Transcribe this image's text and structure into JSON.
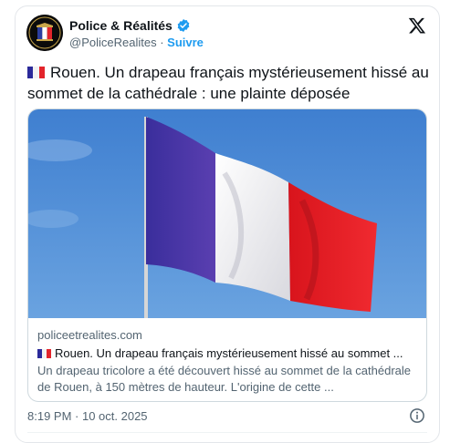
{
  "account": {
    "name": "Police & Réalités",
    "handle": "@PoliceRealites",
    "separator": "·",
    "follow_label": "Suivre",
    "verified_color": "#1d9bf0",
    "avatar_icon": "police-badge-logo"
  },
  "tweet": {
    "flag_icon": "french-flag-emoji",
    "text": "Rouen. Un drapeau français mystérieusement hissé au sommet de la cathédrale : une plainte déposée"
  },
  "link_card": {
    "domain": "policeetrealites.com",
    "title": "Rouen. Un drapeau français mystérieusement hissé au sommet ...",
    "description": "Un drapeau tricolore a été découvert hissé au sommet de la cathédrale de Rouen, à 150 mètres de hauteur. L'origine de cette ...",
    "image_subject": "French tricolour flag waving against blue sky"
  },
  "footer": {
    "timestamp": "8:19 PM · 10 oct. 2025",
    "info_icon": "info-icon"
  },
  "colors": {
    "flag_blue": "#2b2a9a",
    "flag_white": "#ffffff",
    "flag_red": "#e3242b",
    "sky": "#4f8fd6",
    "link": "#1d9bf0"
  }
}
